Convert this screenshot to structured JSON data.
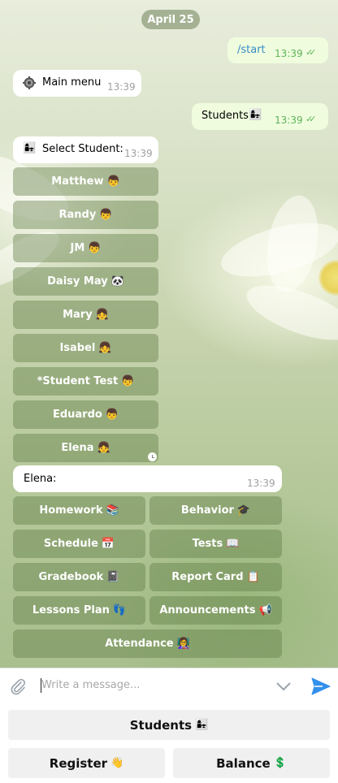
{
  "date_label": "April 25",
  "messages": [
    {
      "text": "/start",
      "time": "13:39",
      "direction": "out"
    },
    {
      "icon": "gear-icon",
      "text": "Main menu",
      "time": "13:39",
      "direction": "in"
    },
    {
      "text": "Students",
      "emoji": "👩‍👧",
      "time": "13:39",
      "direction": "out"
    },
    {
      "emoji": "👩‍👧",
      "text": "Select Student:",
      "time": "13:39",
      "direction": "in"
    },
    {
      "text": "Elena:",
      "time": "13:39",
      "direction": "in"
    }
  ],
  "student_buttons": [
    {
      "label": "Matthew",
      "emoji": "👦"
    },
    {
      "label": "Randy",
      "emoji": "👦"
    },
    {
      "label": "JM",
      "emoji": "👦"
    },
    {
      "label": "Daisy May",
      "emoji": "🐼"
    },
    {
      "label": "Mary",
      "emoji": "👧"
    },
    {
      "label": "Isabel",
      "emoji": "👧"
    },
    {
      "label": "*Student Test",
      "emoji": "👦"
    },
    {
      "label": "Eduardo",
      "emoji": "👦"
    },
    {
      "label": "Elena",
      "emoji": "👧"
    }
  ],
  "menu_buttons": [
    {
      "label": "Homework",
      "emoji": "📚"
    },
    {
      "label": "Behavior",
      "emoji": "🎓"
    },
    {
      "label": "Schedule",
      "emoji": "📅"
    },
    {
      "label": "Tests",
      "emoji": "📖"
    },
    {
      "label": "Gradebook",
      "emoji": "📓"
    },
    {
      "label": "Report Card",
      "emoji": "📋"
    },
    {
      "label": "Lessons Plan",
      "emoji": "👣"
    },
    {
      "label": "Announcements",
      "emoji": "📢"
    },
    {
      "label": "Attendance",
      "emoji": "👩‍🏫"
    }
  ],
  "composer": {
    "placeholder": "Write a message..."
  },
  "reply_keyboard": [
    {
      "label": "Students",
      "emoji": "👩‍👧"
    },
    {
      "label": "Register",
      "emoji": "👋"
    },
    {
      "label": "Balance",
      "emoji": "💲"
    }
  ]
}
